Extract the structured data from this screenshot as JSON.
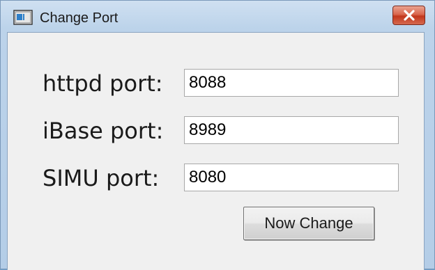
{
  "window": {
    "title": "Change Port",
    "icon": "app-window-icon",
    "close_icon": "close-icon"
  },
  "fields": {
    "httpd": {
      "label": "httpd port:",
      "value": "8088"
    },
    "ibase": {
      "label": "iBase port:",
      "value": "8989"
    },
    "simu": {
      "label": "SIMU port:",
      "value": "8080"
    }
  },
  "actions": {
    "change_label": "Now Change"
  },
  "colors": {
    "close_button": "#c94a30",
    "title_bar": "#bcd3ea",
    "client_bg": "#f0f0f0"
  }
}
